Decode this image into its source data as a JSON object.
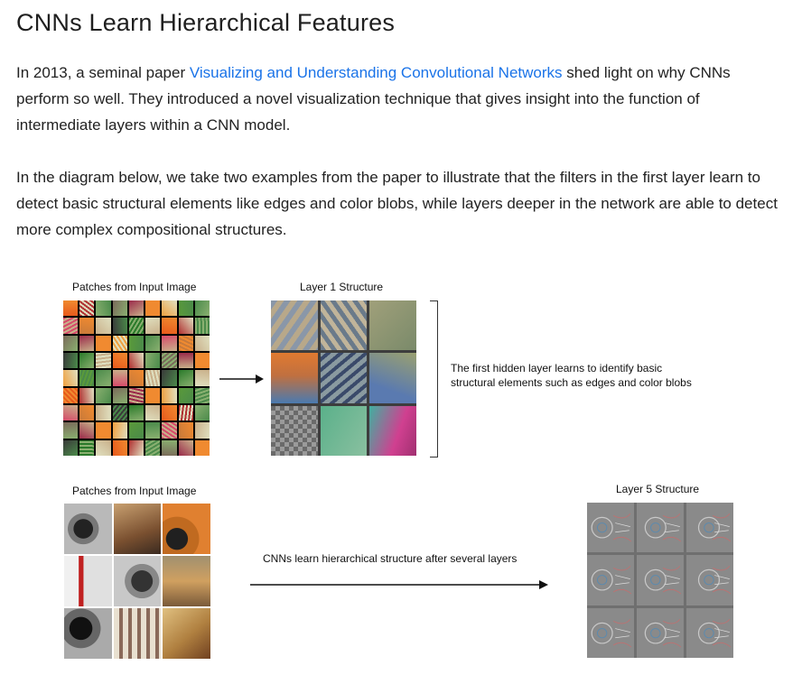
{
  "article": {
    "title": "CNNs Learn Hierarchical Features",
    "p1_before": "In 2013, a seminal paper ",
    "p1_link": "Visualizing and Understanding Convolutional Networks",
    "p1_after": " shed light on why CNNs perform so well. They introduced a novel visualization technique that gives insight into the function of intermediate layers within a CNN model.",
    "p2": "In the diagram below, we take two examples from the paper to illustrate that the filters in the first layer learn to detect basic structural elements like edges and color blobs, while layers deeper in the network are able to detect more complex compositional structures."
  },
  "diagram": {
    "top_left_caption": "Patches from Input Image",
    "top_mid_caption": "Layer 1 Structure",
    "top_note_line1": "The first hidden layer learns to identify basic",
    "top_note_line2": "structural elements such as edges and color blobs",
    "bottom_left_caption": "Patches from Input Image",
    "bottom_right_caption": "Layer 5 Structure",
    "bottom_note": "CNNs learn hierarchical structure after several  layers"
  },
  "colors": {
    "link": "#1a73e8",
    "text": "#222222"
  }
}
